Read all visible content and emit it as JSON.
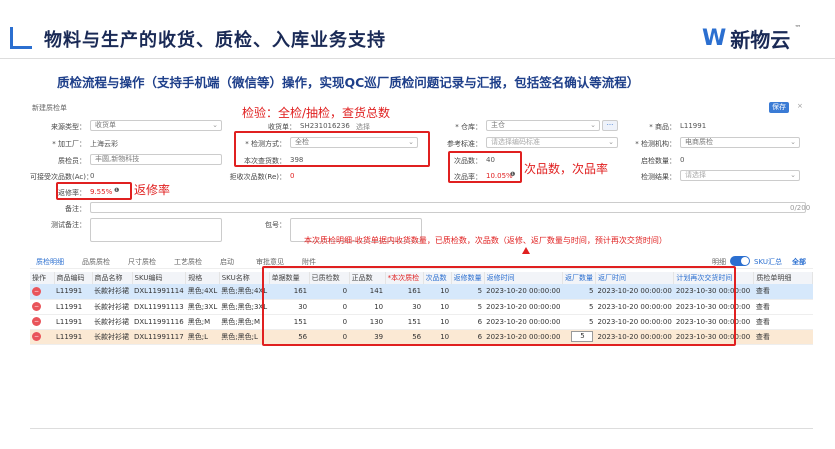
{
  "slide": {
    "title": "物料与生产的收货、质检、入库业务支持",
    "subtitle": "质检流程与操作（支持手机端（微信等）操作，实现QC巡厂质检问题记录与汇报，包括签名确认等流程）",
    "logo_text": "新物云",
    "logo_tm": "™"
  },
  "window": {
    "title": "新建质检单",
    "save_label": "保存",
    "close": "×"
  },
  "form": {
    "source_type_label": "来源类型：",
    "source_type_value": "收货单",
    "receipt_no_label": "收货单：",
    "receipt_no_value": "SH231016236",
    "receipt_select": "选择",
    "warehouse_label": "* 仓库：",
    "warehouse_value": "主仓",
    "warehouse_more": "···",
    "product_label": "* 商品：",
    "product_value": "L11991",
    "factory_label": "* 加工厂：",
    "factory_value": "上海云彩",
    "inspect_method_label": "* 检测方式：",
    "inspect_method_value": "全检",
    "ref_std_label": "参考标准：",
    "ref_std_placeholder": "请选择编码标准",
    "inspect_org_label": "* 检测机构：",
    "inspect_org_value": "电商质检",
    "inspector_label": "质检员：",
    "inspector_value": "丰圆,新物科技",
    "check_total_label": "本次查货数：",
    "check_total_value": "398",
    "defect_count_label": "次品数：",
    "defect_count_value": "40",
    "pass_count_label": "启检数量：",
    "pass_count_value": "0",
    "accept_defect_label": "可接受次品数(Ac)：",
    "accept_defect_value": "0",
    "reject_defect_label": "拒收次品数(Re)：",
    "reject_defect_value": "0",
    "defect_rate_label": "次品率：",
    "defect_rate_value": "10.05%",
    "result_label": "检测结果：",
    "result_placeholder": "请选择",
    "return_rate_label": "返修率：",
    "return_rate_value": "9.55%",
    "remark_label": "备注：",
    "remark_counter": "0/200",
    "test_remark_label": "测试备注：",
    "package_label": "包号："
  },
  "annotations": {
    "inspection": "检验：全检/抽检，查货总数",
    "defect": "次品数，次品率",
    "return_rate": "返修率",
    "detail": "本次质检明细-收货单据内收货数量，已质检数，次品数（返修、返厂数量与时间，预计再次交货时间）"
  },
  "tabs": [
    "质检明细",
    "品质质检",
    "尺寸质检",
    "工艺质检",
    "启动",
    "审批意见",
    "附件"
  ],
  "toolbar": {
    "detail_label": "明细",
    "sku_summary": "SKU汇总",
    "all_label": "全部"
  },
  "table": {
    "headers": [
      "操作",
      "商品编码",
      "商品名称",
      "SKU编码",
      "规格",
      "SKU名称",
      "单据数量",
      "已质检数",
      "正品数",
      "*本次质检",
      "次品数",
      "返修数量",
      "返修时间",
      "返厂数量",
      "返厂时间",
      "计划再次交货时间",
      "质检单明细"
    ],
    "rows": [
      {
        "del": "−",
        "code": "L11991",
        "name": "长款衬衫裙",
        "sku": "DXL11991114",
        "spec": "黑色;4XL",
        "sku_name": "黑色;黑色;4XL",
        "qty": "161",
        "inspected": "0",
        "good": "141",
        "this_inspect": "161",
        "defect": "10",
        "return_qty": "5",
        "return_time": "2023-10-20 00:00:00",
        "factory_qty": "5",
        "factory_time": "2023-10-20 00:00:00",
        "plan_time": "2023-10-30 00:00:00",
        "action": "查看"
      },
      {
        "del": "−",
        "code": "L11991",
        "name": "长款衬衫裙",
        "sku": "DXL11991113",
        "spec": "黑色;3XL",
        "sku_name": "黑色;黑色;3XL",
        "qty": "30",
        "inspected": "0",
        "good": "10",
        "this_inspect": "30",
        "defect": "10",
        "return_qty": "5",
        "return_time": "2023-10-20 00:00:00",
        "factory_qty": "5",
        "factory_time": "2023-10-20 00:00:00",
        "plan_time": "2023-10-30 00:00:00",
        "action": "查看"
      },
      {
        "del": "−",
        "code": "L11991",
        "name": "长款衬衫裙",
        "sku": "DXL11991116",
        "spec": "黑色;M",
        "sku_name": "黑色;黑色;M",
        "qty": "151",
        "inspected": "0",
        "good": "130",
        "this_inspect": "151",
        "defect": "10",
        "return_qty": "6",
        "return_time": "2023-10-20 00:00:00",
        "factory_qty": "5",
        "factory_time": "2023-10-20 00:00:00",
        "plan_time": "2023-10-30 00:00:00",
        "action": "查看"
      },
      {
        "del": "−",
        "code": "L11991",
        "name": "长款衬衫裙",
        "sku": "DXL11991117",
        "spec": "黑色;L",
        "sku_name": "黑色;黑色;L",
        "qty": "56",
        "inspected": "0",
        "good": "39",
        "this_inspect": "56",
        "defect": "10",
        "return_qty": "6",
        "return_time": "2023-10-20 00:00:00",
        "factory_qty": "5",
        "factory_time": "2023-10-20 00:00:00",
        "plan_time": "2023-10-30 00:00:00",
        "action": "查看"
      }
    ]
  },
  "colors": {
    "accent": "#2b6fd0",
    "title": "#1a2a56",
    "subtitle": "#1e3f8a",
    "annotation": "#e02020"
  }
}
